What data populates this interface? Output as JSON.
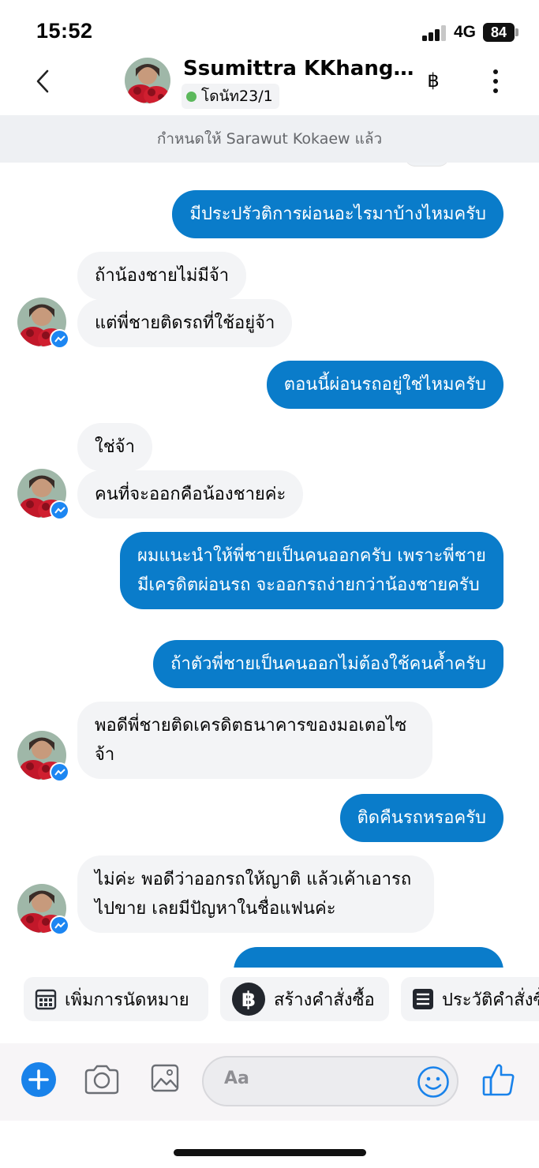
{
  "status_bar": {
    "time": "15:52",
    "network": "4G",
    "battery": "84"
  },
  "header": {
    "contact_name": "Ssumittra KKhangk...",
    "label": "โดนัท23/1",
    "baht_symbol": "฿"
  },
  "assign_banner": "กำหนดให้ Sarawut Kokaew แล้ว",
  "messages": [
    {
      "side": "out",
      "text": "มีประปรัวติการผ่อนอะไรมาบ้างไหมครับ"
    },
    {
      "side": "in",
      "text": "ถ้าน้องชายไม่มีจ้า"
    },
    {
      "side": "in",
      "text": "แต่พี่ชายติดรถที่ใช้อยู่จ้า"
    },
    {
      "side": "out",
      "text": "ตอนนี้ผ่อนรถอยู่ใช่ไหมครับ"
    },
    {
      "side": "in",
      "text": "ใช่จ้า"
    },
    {
      "side": "in",
      "text": "คนที่จะออกคือน้องชายค่ะ"
    },
    {
      "side": "out",
      "text": "ผมแนะนำให้พี่ชายเป็นคนออกครับ เพราะพี่ชายมีเครดิตผ่อนรถ จะออกรถง่ายกว่าน้องชายครับ"
    },
    {
      "side": "out",
      "text": "ถ้าตัวพี่ชายเป็นคนออกไม่ต้องใช้คนค้ำครับ"
    },
    {
      "side": "in",
      "text": "พอดีพี่ชายติดเครดิตธนาคารของมอเตอไซจ้า"
    },
    {
      "side": "out",
      "text": "ติดคืนรถหรอครับ"
    },
    {
      "side": "in",
      "text": "ไม่ค่ะ พอดีว่าออกรถให้ญาติ แล้วเค้าเอารถไปขาย เลยมีปัญหาในชื่อแฟนค่ะ"
    }
  ],
  "quick_actions": [
    {
      "label": "เพิ่มการนัดหมาย",
      "icon": "calendar-icon"
    },
    {
      "label": "สร้างคำสั่งซื้อ",
      "icon": "baht-icon"
    },
    {
      "label": "ประวัติคำสั่งซื้อ",
      "icon": "order-list-icon"
    }
  ],
  "composer": {
    "placeholder": "Aa"
  },
  "colors": {
    "outgoing_bubble": "#0a7cca",
    "incoming_bubble": "#f3f4f6",
    "accent": "#1982ea",
    "online_dot": "#5cb85c"
  }
}
